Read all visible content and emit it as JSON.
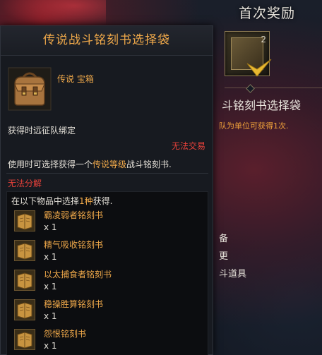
{
  "background": {
    "panel_title": "首次奖励",
    "reward_count": "2",
    "item_name_partial": "斗铭刻书选择袋",
    "hint_partial": "队为单位可获得1次.",
    "list_partial": [
      "备",
      "更",
      "斗道具"
    ]
  },
  "tooltip": {
    "title": "传说战斗铭刻书选择袋",
    "grade_line": "传说 宝箱",
    "bound": "获得时远征队绑定",
    "no_trade": "无法交易",
    "usage_before": "使用时可选择获得一个",
    "usage_highlight": "传说等级",
    "usage_after": "战斗铭刻书.",
    "no_dismantle": "无法分解",
    "choice_header_before": "在以下物品中选择",
    "choice_header_highlight": "1种",
    "choice_header_after": "获得.",
    "items": [
      {
        "name": "霸凌弱者铭刻书",
        "qty": "x 1"
      },
      {
        "name": "精气吸收铭刻书",
        "qty": "x 1"
      },
      {
        "name": "以太捕食者铭刻书",
        "qty": "x 1"
      },
      {
        "name": "稳操胜算铭刻书",
        "qty": "x 1"
      },
      {
        "name": "怨恨铭刻书",
        "qty": "x 1"
      }
    ]
  },
  "colors": {
    "legendary": "#f0a94a",
    "warning": "#e8413a",
    "text": "#e4e0d8"
  },
  "icons": [
    "leather-bag-icon",
    "engraving-book-icon",
    "check-mark-icon"
  ]
}
